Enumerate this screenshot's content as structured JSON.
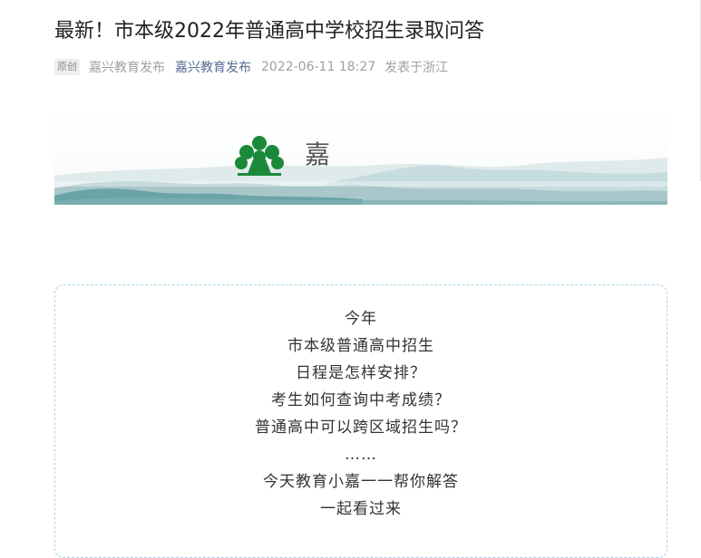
{
  "article": {
    "title": "最新！市本级2022年普通高中学校招生录取问答",
    "meta": {
      "original_tag": "原创",
      "author": "嘉兴教育发布",
      "account": "嘉兴教育发布",
      "date": "2022-06-11 18:27",
      "location": "发表于浙江"
    },
    "banner": {
      "logo": "tree-logo-icon",
      "character": "嘉",
      "colors": {
        "logo_green": "#1a8a3a",
        "mountain_teal": "#5f9ea0",
        "mountain_light": "#b9d3d6"
      }
    },
    "intro": {
      "lines": [
        "今年",
        "市本级普通高中招生",
        "日程是怎样安排？",
        "考生如何查询中考成绩？",
        "普通高中可以跨区域招生吗？",
        "……",
        "今天教育小嘉一一帮你解答",
        "一起看过来"
      ],
      "border_color": "#a9d3e6"
    }
  }
}
